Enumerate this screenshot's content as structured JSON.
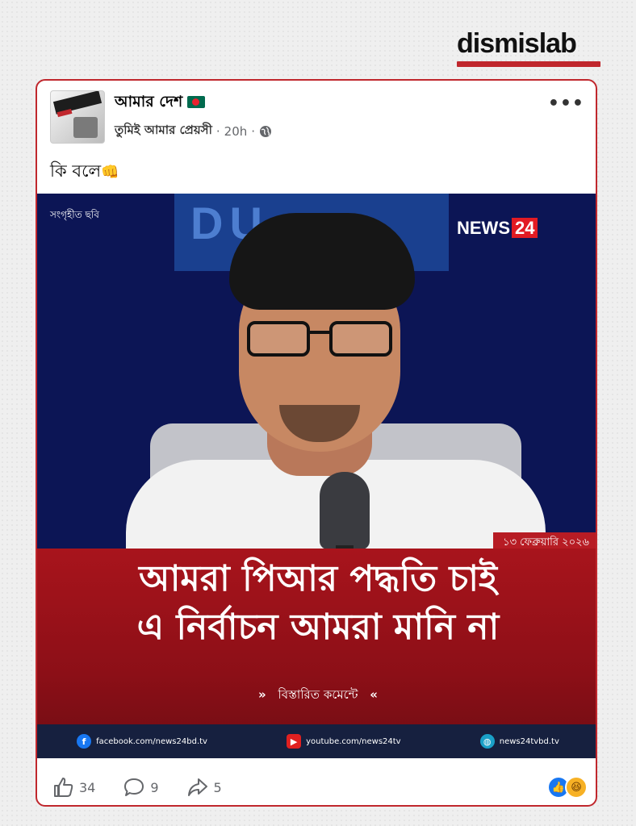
{
  "brand": {
    "name": "dismislab"
  },
  "post": {
    "page_name": "আমার দেশ",
    "source_group": "তুমিই আমার প্রেয়সী",
    "separator": "·",
    "time": "20h",
    "caption": "কি বলে",
    "caption_emoji": "👊"
  },
  "media": {
    "credit": "সংগৃহীত ছবি",
    "channel_logo": {
      "text": "NEWS",
      "number": "24"
    },
    "date": "১৩ ফেব্রুয়ারি ২০২৬",
    "headline_line1": "আমরা পিআর পদ্ধতি চাই",
    "headline_line2": "এ নির্বাচন আমরা মানি না",
    "details_text": "বিস্তারিত কমেন্টে",
    "details_left": "»",
    "details_right": "«",
    "sources": [
      {
        "icon": "facebook-icon",
        "glyph": "f",
        "text": "facebook.com/news24bd.tv"
      },
      {
        "icon": "youtube-icon",
        "glyph": "▶",
        "text": "youtube.com/news24tv"
      },
      {
        "icon": "globe-icon",
        "glyph": "◍",
        "text": "news24tvbd.tv"
      }
    ]
  },
  "actions": {
    "likes": "34",
    "comments": "9",
    "shares": "5"
  },
  "colors": {
    "accent": "#c0272d",
    "banner": "#8c0f17",
    "facebook_blue": "#1877f2"
  }
}
